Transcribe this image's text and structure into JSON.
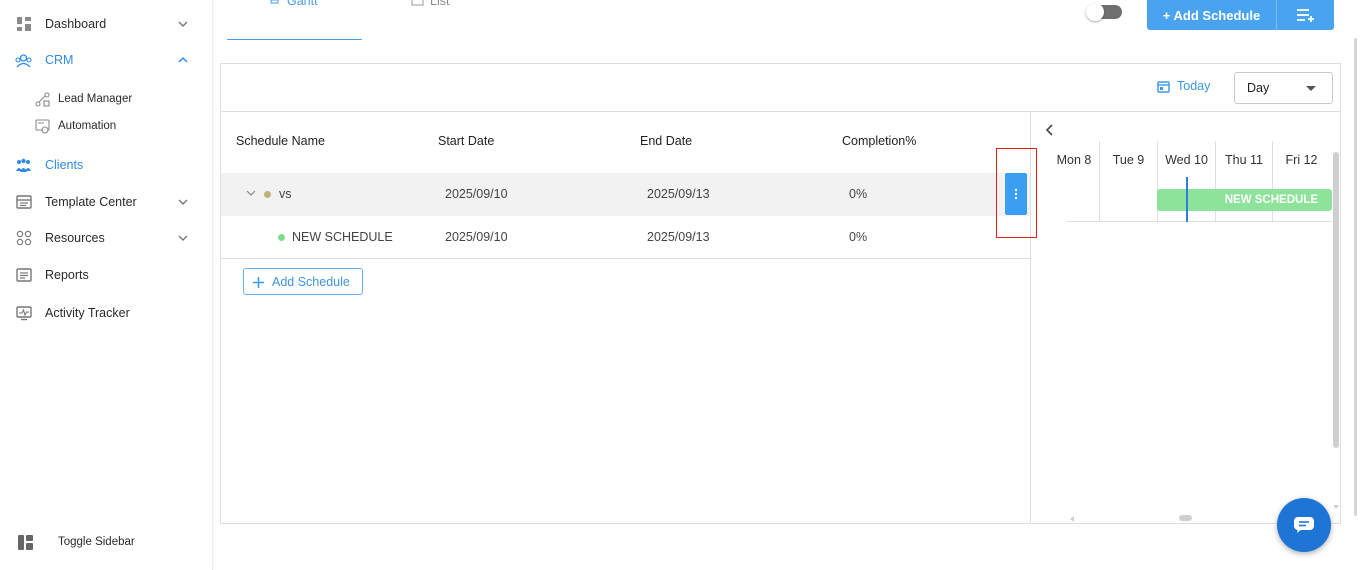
{
  "sidebar": {
    "items": [
      {
        "label": "Dashboard",
        "icon": "dashboard-icon"
      },
      {
        "label": "CRM",
        "icon": "crm-icon"
      },
      {
        "label": "Lead Manager",
        "icon": "lead-manager-icon"
      },
      {
        "label": "Automation",
        "icon": "automation-icon"
      },
      {
        "label": "Clients",
        "icon": "clients-icon"
      },
      {
        "label": "Template Center",
        "icon": "template-center-icon"
      },
      {
        "label": "Resources",
        "icon": "resources-icon"
      },
      {
        "label": "Reports",
        "icon": "reports-icon"
      },
      {
        "label": "Activity Tracker",
        "icon": "activity-tracker-icon"
      }
    ],
    "toggle_label": "Toggle Sidebar"
  },
  "tabs": {
    "gantt": "Gantt",
    "list": "List"
  },
  "header": {
    "add_schedule_label": "+ Add Schedule"
  },
  "toolbar": {
    "today_label": "Today",
    "view_select": "Day"
  },
  "grid": {
    "columns": [
      "Schedule Name",
      "Start Date",
      "End Date",
      "Completion%"
    ],
    "rows": [
      {
        "name": "vs",
        "start": "2025/09/10",
        "end": "2025/09/13",
        "completion": "0%",
        "dot_color": "#c2b07a"
      },
      {
        "name": "NEW SCHEDULE",
        "start": "2025/09/10",
        "end": "2025/09/13",
        "completion": "0%",
        "dot_color": "#7fdc8c"
      }
    ],
    "add_schedule_label": "Add Schedule"
  },
  "timeline": {
    "days": [
      "Mon 8",
      "Tue 9",
      "Wed 10",
      "Thu 11",
      "Fri 12"
    ],
    "bar_label": "NEW SCHEDULE"
  },
  "colors": {
    "accent": "#4aa3ef",
    "bar": "#8de39a",
    "today_line": "#2f7fe0",
    "highlight": "#e02020"
  }
}
